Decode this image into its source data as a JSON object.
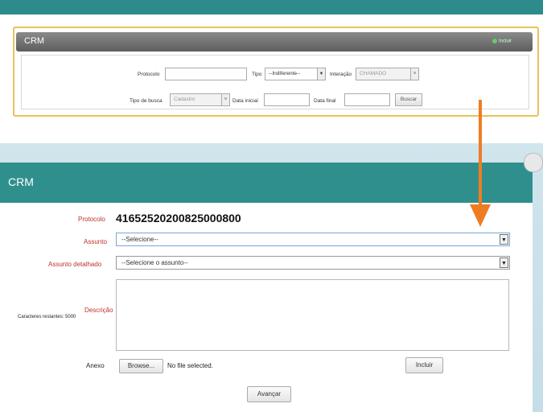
{
  "search_panel": {
    "title": "CRM",
    "header_link": "Incluir",
    "protocolo_label": "Protocolo",
    "protocolo_value": "",
    "tipo_label": "Tipo",
    "tipo_value": "--Indiferente--",
    "interacao_label": "Interação",
    "interacao_value": "CHAMADO",
    "tipo_busca_label": "Tipo de busca",
    "tipo_busca_value": "Cadastro",
    "data_inicial_label": "Data inicial",
    "data_final_label": "Data final",
    "buscar_label": "Buscar"
  },
  "form_panel": {
    "title": "CRM",
    "protocolo_label": "Protocolo",
    "protocolo_value": "416525202008250008​00",
    "assunto_label": "Assunto",
    "assunto_value": "--Selecione--",
    "assunto_detalhado_label": "Assunto detalhado",
    "assunto_detalhado_value": "--Selecione o assunto--",
    "descricao_label": "Descrição",
    "caracteres_label": "Caracteres restantes: 5000",
    "anexo_label": "Anexo",
    "browse_label": "Browse...",
    "file_status": "No file selected.",
    "incluir_label": "Incluir",
    "avancar_label": "Avançar"
  },
  "colors": {
    "header_teal": "#2f8f8d",
    "highlight_border": "#e8c35a",
    "arrow_orange": "#ee7d22",
    "required_label": "#c0302c"
  },
  "icons": [
    "dropdown-arrow-icon",
    "close-icon",
    "plus-icon",
    "down-arrow-annotation"
  ]
}
